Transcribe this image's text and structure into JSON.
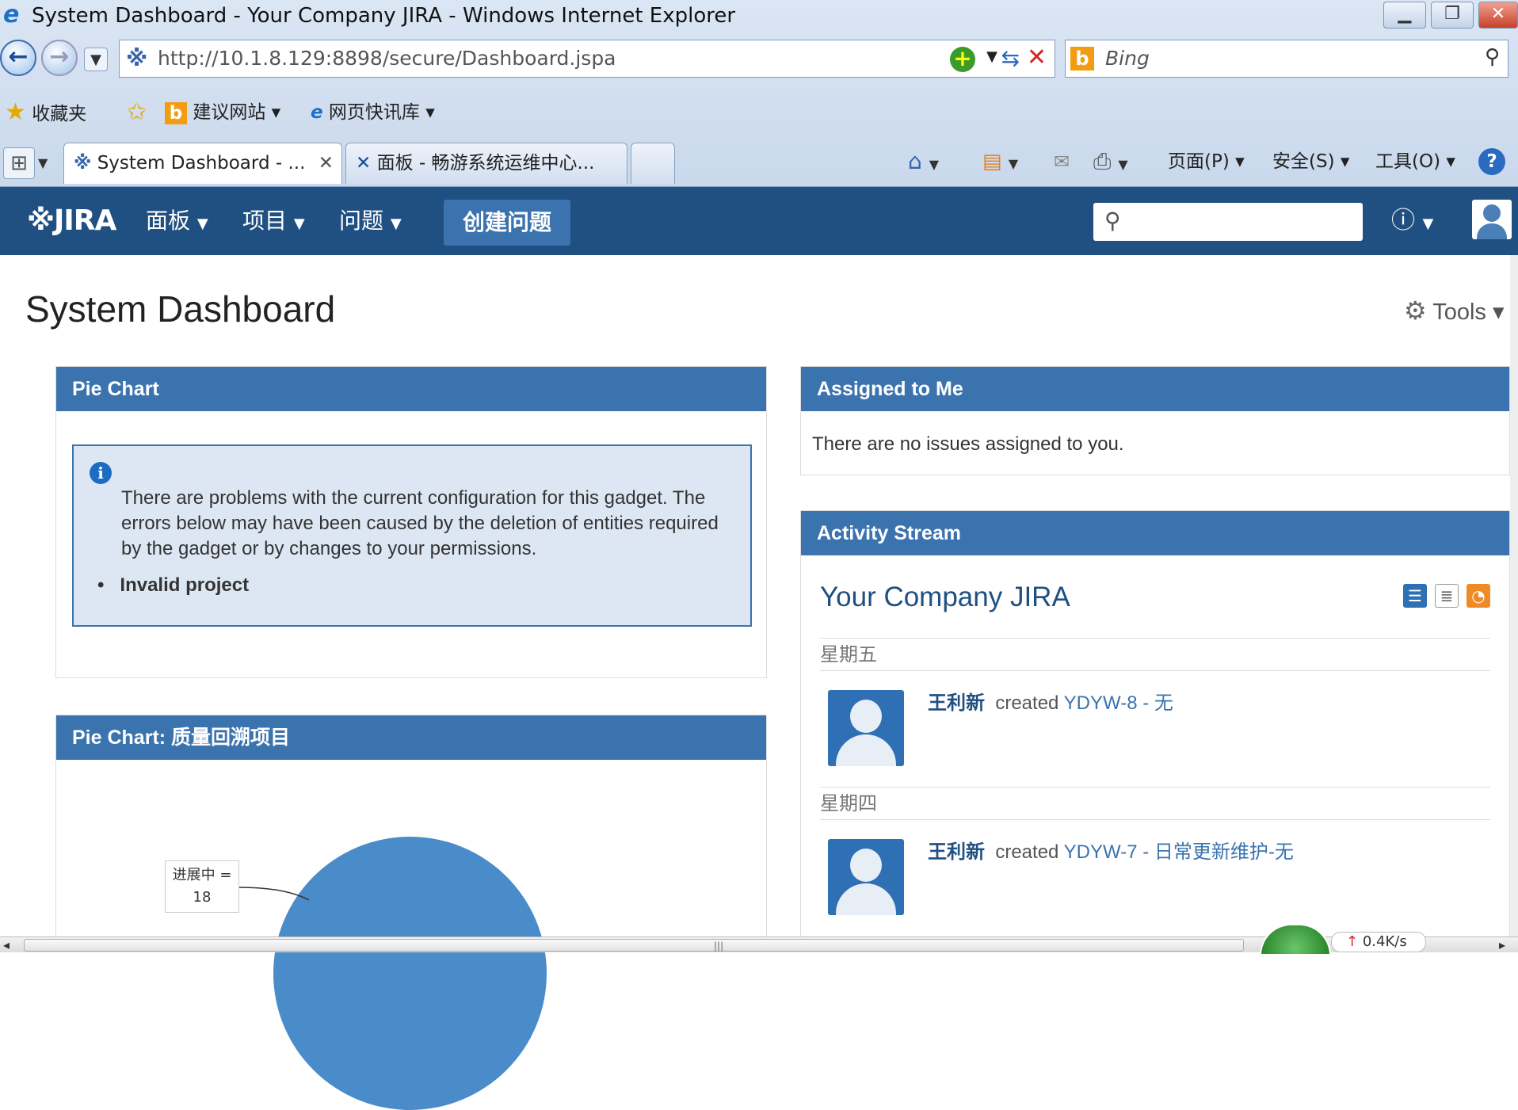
{
  "browser": {
    "window_title": "System Dashboard - Your Company JIRA - Windows Internet Explorer",
    "url": "http://10.1.8.129:8898/secure/Dashboard.jspa",
    "search_placeholder": "Bing",
    "favorites_label": "收藏夹",
    "suggested_sites": "建议网站",
    "web_slice_gallery": "网页快讯库",
    "tabs": [
      {
        "label": "System Dashboard - ..."
      },
      {
        "label": "面板 - 畅游系统运维中心..."
      }
    ],
    "commands": {
      "page": "页面(P)",
      "safety": "安全(S)",
      "tools": "工具(O)"
    },
    "net_speed": "0.4K/s"
  },
  "jira": {
    "logo": "JIRA",
    "nav": {
      "dashboards": "面板",
      "projects": "项目",
      "issues": "问题"
    },
    "create_button": "创建问题",
    "page_title": "System Dashboard",
    "tools_label": "Tools"
  },
  "gadgets": {
    "pie_chart": {
      "title": "Pie Chart",
      "message": "There are problems with the current configuration for this gadget. The errors below may have been caused by the deletion of entities required by the gadget or by changes to your permissions.",
      "error_item": "Invalid project"
    },
    "pie_chart_quality": {
      "title": "Pie Chart: 质量回溯项目",
      "label_name": "进展中 =",
      "label_value": "18"
    },
    "assigned": {
      "title": "Assigned to Me",
      "empty_text": "There are no issues assigned to you."
    },
    "activity": {
      "title": "Activity Stream",
      "heading": "Your Company JIRA",
      "groups": [
        {
          "day": "星期五",
          "user": "王利新",
          "action": "created",
          "issue": "YDYW-8 - 无"
        },
        {
          "day": "星期四",
          "user": "王利新",
          "action": "created",
          "issue": "YDYW-7 - 日常更新维护-无"
        }
      ]
    }
  },
  "colors": {
    "header": "#205081",
    "gadget_header": "#3b73af",
    "link": "#3b73af"
  }
}
